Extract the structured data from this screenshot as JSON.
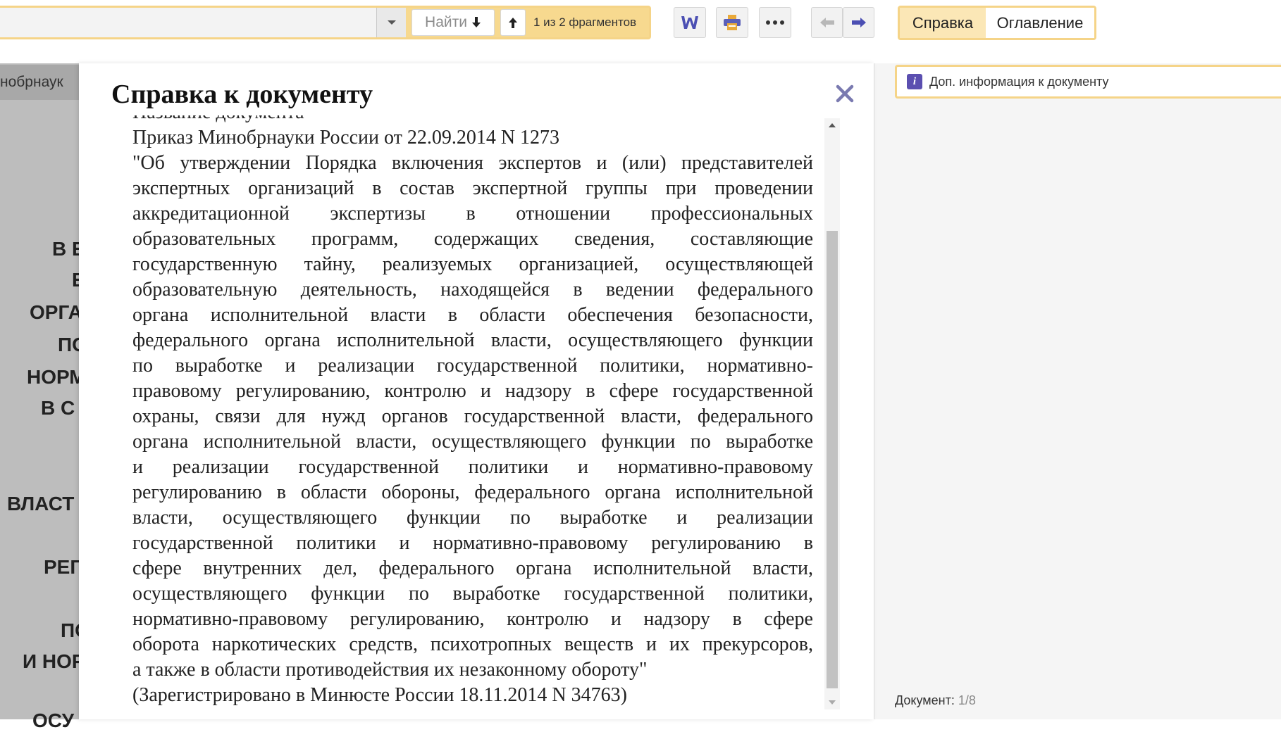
{
  "toolbar": {
    "search_value": "",
    "find_label": "Найти",
    "fragments": "1 из 2 фрагментов",
    "tabs": [
      {
        "label": "Справка",
        "active": true
      },
      {
        "label": "Оглавление",
        "active": false
      }
    ]
  },
  "background_doc": {
    "tab_label": "нобрнаук",
    "words": [
      "В Е",
      "Е",
      "ОРГА",
      "ПО",
      "НОРМ",
      "В С",
      "ВЛАСТ",
      "РЕГ",
      "ПО",
      "И НОР",
      "ОСУ"
    ]
  },
  "modal": {
    "title": "Справка к документу",
    "section_heading": "Название документа",
    "doc_name": "Приказ Минобрнауки России от 22.09.2014 N 1273",
    "lines": [
      "\"Об утверждении Порядка включения экспертов и (или) представителей",
      "экспертных организаций в состав экспертной группы при проведении",
      "аккредитационной экспертизы в отношении профессиональных",
      "образовательных программ, содержащих сведения, составляющие",
      "государственную тайну, реализуемых организацией, осуществляющей",
      "образовательную деятельность, находящейся в ведении федерального",
      "органа исполнительной власти в области обеспечения безопасности,",
      "федерального органа исполнительной власти, осуществляющего функции",
      "по выработке и реализации государственной политики, нормативно-",
      "правовому регулированию, контролю и надзору в сфере государственной",
      "охраны, связи для нужд органов государственной власти, федерального",
      "органа исполнительной власти, осуществляющего функции по выработке",
      "и реализации государственной политики и нормативно-правовому",
      "регулированию в области обороны, федерального органа исполнительной",
      "власти, осуществляющего функции по выработке и реализации",
      "государственной политики и нормативно-правовому регулированию в",
      "сфере внутренних дел, федерального органа исполнительной власти,",
      "осуществляющего функции по выработке государственной политики,",
      "нормативно-правовому регулированию, контролю и надзору в сфере",
      "оборота наркотических средств, психотропных веществ и их прекурсоров,"
    ],
    "last_line": "а также в области противодействия их незаконному обороту\"",
    "registration": "(Зарегистрировано в Минюсте России 18.11.2014 N 34763)"
  },
  "side_panel": {
    "info_label": "Доп. информация к документу",
    "info_icon_letter": "i",
    "doc_counter_label": "Документ: ",
    "doc_counter_value": "1/8"
  },
  "colors": {
    "accent": "#f5d488",
    "active_tab": "#fbe7b6",
    "icon_purple": "#5b4fb0",
    "overlay_gray": "#bdbdbd"
  }
}
